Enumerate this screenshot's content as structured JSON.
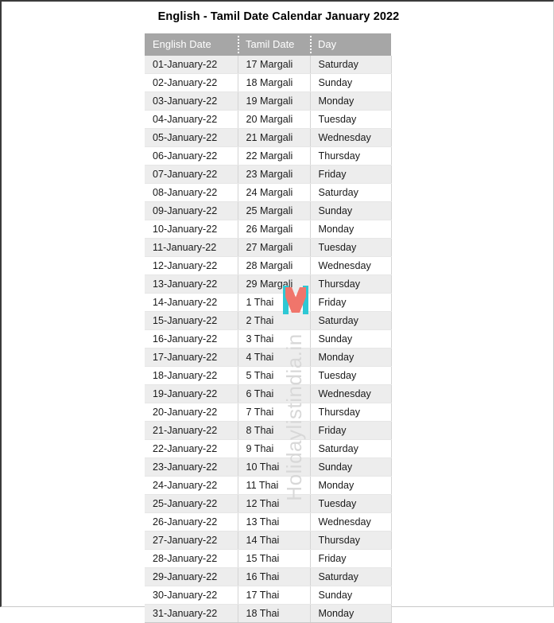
{
  "page": {
    "title": "English - Tamil Date Calendar January 2022"
  },
  "table": {
    "headers": [
      "English Date",
      "Tamil Date",
      "Day"
    ],
    "rows": [
      [
        "01-January-22",
        "17 Margali",
        "Saturday"
      ],
      [
        "02-January-22",
        "18 Margali",
        "Sunday"
      ],
      [
        "03-January-22",
        "19 Margali",
        "Monday"
      ],
      [
        "04-January-22",
        "20 Margali",
        "Tuesday"
      ],
      [
        "05-January-22",
        "21 Margali",
        "Wednesday"
      ],
      [
        "06-January-22",
        "22 Margali",
        "Thursday"
      ],
      [
        "07-January-22",
        "23 Margali",
        "Friday"
      ],
      [
        "08-January-22",
        "24 Margali",
        "Saturday"
      ],
      [
        "09-January-22",
        "25 Margali",
        "Sunday"
      ],
      [
        "10-January-22",
        "26 Margali",
        "Monday"
      ],
      [
        "11-January-22",
        "27 Margali",
        "Tuesday"
      ],
      [
        "12-January-22",
        "28 Margali",
        "Wednesday"
      ],
      [
        "13-January-22",
        "29 Margali",
        "Thursday"
      ],
      [
        "14-January-22",
        "1 Thai",
        "Friday"
      ],
      [
        "15-January-22",
        "2 Thai",
        "Saturday"
      ],
      [
        "16-January-22",
        "3 Thai",
        "Sunday"
      ],
      [
        "17-January-22",
        "4 Thai",
        "Monday"
      ],
      [
        "18-January-22",
        "5 Thai",
        "Tuesday"
      ],
      [
        "19-January-22",
        "6 Thai",
        "Wednesday"
      ],
      [
        "20-January-22",
        "7 Thai",
        "Thursday"
      ],
      [
        "21-January-22",
        "8 Thai",
        "Friday"
      ],
      [
        "22-January-22",
        "9 Thai",
        "Saturday"
      ],
      [
        "23-January-22",
        "10 Thai",
        "Sunday"
      ],
      [
        "24-January-22",
        "11 Thai",
        "Monday"
      ],
      [
        "25-January-22",
        "12 Thai",
        "Tuesday"
      ],
      [
        "26-January-22",
        "13 Thai",
        "Wednesday"
      ],
      [
        "27-January-22",
        "14 Thai",
        "Thursday"
      ],
      [
        "28-January-22",
        "15 Thai",
        "Friday"
      ],
      [
        "29-January-22",
        "16 Thai",
        "Saturday"
      ],
      [
        "30-January-22",
        "17 Thai",
        "Sunday"
      ],
      [
        "31-January-22",
        "18 Thai",
        "Monday"
      ]
    ]
  },
  "watermark": {
    "text": "Holidaylistindia.in",
    "logo_name": "m-logo-icon",
    "logo_color_primary": "#2ec8d4",
    "logo_color_secondary": "#f0756b"
  },
  "colors": {
    "header_bg": "#a6a6a6",
    "header_text": "#ffffff",
    "row_stripe": "#ededed",
    "row_plain": "#ffffff",
    "cell_border": "#d4d4d4",
    "page_border": "#3a3a3a",
    "watermark_text": "#d8d8d8"
  }
}
